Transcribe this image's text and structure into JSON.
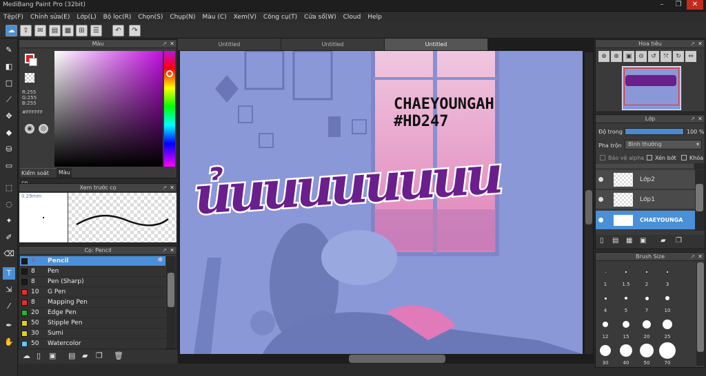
{
  "app": {
    "title": "MediBang Paint Pro (32bit)",
    "min": "–",
    "max": "❐",
    "close": "✕"
  },
  "menu": [
    "Tệp(F)",
    "Chỉnh sửa(E)",
    "Lớp(L)",
    "Bộ lọc(R)",
    "Chọn(S)",
    "Chụp(N)",
    "Màu (C)",
    "Xem(V)",
    "Công cụ(T)",
    "Cửa sổ(W)",
    "Cloud",
    "Help"
  ],
  "color_panel": {
    "title": "Màu",
    "r": "R:255",
    "g": "G:255",
    "b": "B:255",
    "hex": "#FFFFFF",
    "tab1": "Kiểm soát cọ",
    "tab2": "Màu",
    "fg": "#e02020",
    "bg": "#ffffff"
  },
  "preview_panel": {
    "title": "Xem trước cọ",
    "size": "0.29mm"
  },
  "brush_panel": {
    "title": "Cọ: Pencil",
    "items": [
      {
        "size": "4",
        "name": "Pencil",
        "color": "#1a1a1a"
      },
      {
        "size": "8",
        "name": "Pen",
        "color": "#1a1a1a"
      },
      {
        "size": "8",
        "name": "Pen (Sharp)",
        "color": "#1a1a1a"
      },
      {
        "size": "10",
        "name": "G Pen",
        "color": "#e03030"
      },
      {
        "size": "8",
        "name": "Mapping Pen",
        "color": "#e03030"
      },
      {
        "size": "20",
        "name": "Edge Pen",
        "color": "#30b030"
      },
      {
        "size": "50",
        "name": "Stipple Pen",
        "color": "#e0d020"
      },
      {
        "size": "30",
        "name": "Sumi",
        "color": "#e0d020"
      },
      {
        "size": "50",
        "name": "Watercolor",
        "color": "#60c8f0"
      }
    ]
  },
  "tabs": [
    "Untitled",
    "Untitled",
    "Untitled"
  ],
  "art": {
    "caption1": "CHAEYOUNGAH",
    "caption2": "#HD247",
    "word": "ủuuuuuuuu"
  },
  "navigator": {
    "title": "Hoa tiêu"
  },
  "layer_panel": {
    "title": "Lớp",
    "opacity_label": "Độ trong",
    "opacity_value": "100 %",
    "blend_label": "Pha trộn",
    "blend_value": "Bình thường",
    "alpha_protect": "Bảo vệ alpha",
    "clipping": "Xén bớt",
    "lock": "Khóa",
    "layers": [
      "Lớp2",
      "Lớp1",
      "CHAEYOUNGA"
    ]
  },
  "brush_size_panel": {
    "title": "Brush Size",
    "sizes": [
      "1",
      "1.5",
      "2",
      "3",
      "4",
      "5",
      "7",
      "10",
      "12",
      "15",
      "20",
      "25",
      "30",
      "40",
      "50",
      "70"
    ]
  }
}
